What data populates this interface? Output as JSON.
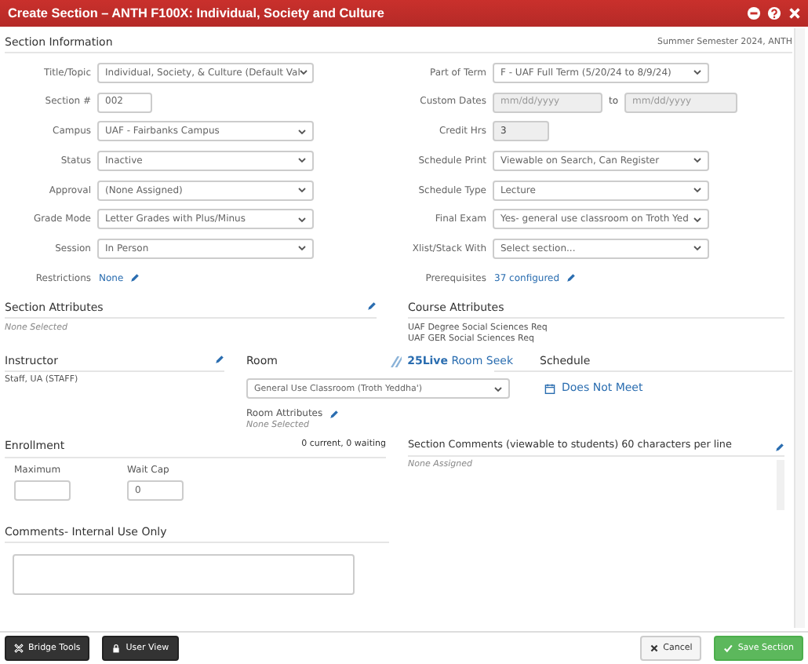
{
  "window": {
    "title": "Create Section – ANTH F100X: Individual, Society and Culture"
  },
  "section_info": {
    "title": "Section Information",
    "term": "Summer Semester 2024, ANTH",
    "left_fields": [
      {
        "label": "Title/Topic",
        "kind": "select",
        "value": "Individual, Society, & Culture (Default Val",
        "disabled": false
      },
      {
        "label": "Section #",
        "kind": "text",
        "value": "002",
        "disabled": false
      },
      {
        "label": "Campus",
        "kind": "select",
        "value": "UAF - Fairbanks Campus",
        "disabled": false
      },
      {
        "label": "Status",
        "kind": "select",
        "value": "Inactive",
        "disabled": false
      },
      {
        "label": "Approval",
        "kind": "select",
        "value": "(None Assigned)",
        "disabled": false
      },
      {
        "label": "Grade Mode",
        "kind": "select",
        "value": "Letter Grades with Plus/Minus",
        "disabled": false
      },
      {
        "label": "Session",
        "kind": "select",
        "value": "In Person",
        "disabled": false
      },
      {
        "label": "Restrictions",
        "kind": "link",
        "value": "None",
        "disabled": false
      }
    ],
    "right_fields": [
      {
        "label": "Part of Term",
        "kind": "select",
        "value": "F - UAF Full Term (5/20/24 to 8/9/24)",
        "disabled": false
      },
      {
        "label": "Custom Dates",
        "kind": "date_range",
        "placeholder": "mm/dd/yyyy",
        "separator": "to",
        "placeholder_end": "mm/dd/yyyy",
        "disabled": true
      },
      {
        "label": "Credit Hrs",
        "kind": "text",
        "value": "3",
        "disabled": true
      },
      {
        "label": "Schedule Print",
        "kind": "select",
        "value": "Viewable on Search, Can Register",
        "disabled": false
      },
      {
        "label": "Schedule Type",
        "kind": "select",
        "value": "Lecture",
        "disabled": false
      },
      {
        "label": "Final Exam",
        "kind": "select",
        "value": "Yes- general use classroom on Troth Yed",
        "disabled": false
      },
      {
        "label": "Xlist/Stack With",
        "kind": "select",
        "value": "Select section...",
        "disabled": false
      },
      {
        "label": "Prerequisites",
        "kind": "link",
        "value": "37 configured",
        "disabled": false
      }
    ]
  },
  "section_attributes": {
    "title": "Section Attributes",
    "empty_text": "None Selected"
  },
  "course_attributes": {
    "title": "Course Attributes",
    "items": [
      "UAF Degree Social Sciences Req",
      "UAF GER Social Sciences Req"
    ]
  },
  "instructor": {
    "title": "Instructor",
    "value": "Staff, UA (STAFF)"
  },
  "room": {
    "title": "Room",
    "seek_link": "**25Live** Room Seek",
    "value": "General Use Classroom (Troth Yeddha')",
    "attributes_title": "Room Attributes",
    "attributes_empty": "None Selected"
  },
  "schedule": {
    "title": "Schedule",
    "link": "Does Not Meet"
  },
  "enrollment": {
    "title": "Enrollment",
    "summary": "0 current, 0 waiting",
    "fields": [
      {
        "label": "Maximum"
      },
      {
        "label": "Wait Cap",
        "value": "0"
      }
    ]
  },
  "section_comments": {
    "title": "Section Comments (viewable to students) 60 characters per line",
    "empty_text": "None Assigned"
  },
  "internal_comments": {
    "title": "Comments- Internal Use Only"
  },
  "buttons_left": [
    {
      "kind": "tools",
      "label": "Bridge Tools"
    },
    {
      "kind": "lock",
      "label": "User View"
    }
  ],
  "buttons_right": [
    {
      "kind": "cancel",
      "label": "Cancel"
    },
    {
      "kind": "save",
      "label": "Save Section"
    }
  ]
}
